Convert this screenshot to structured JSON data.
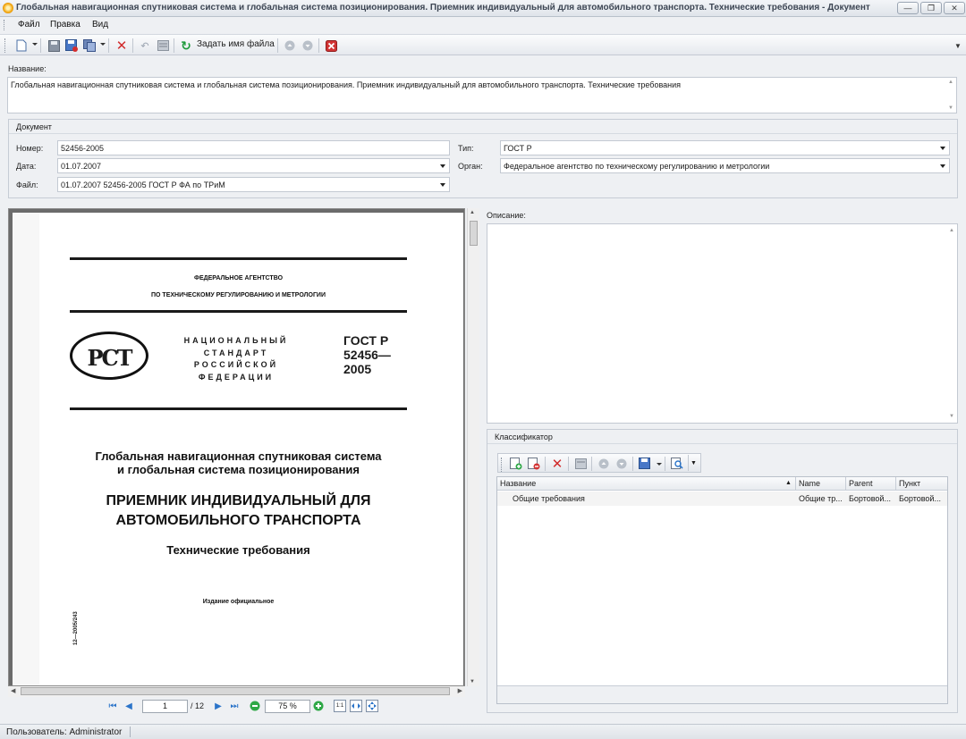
{
  "window": {
    "title": "Глобальная навигационная спутниковая система и глобальная система позиционирования. Приемник индивидуальный для автомобильного транспорта. Технические требования - Документ",
    "buttons": {
      "minimize": "—",
      "restore": "❐",
      "close": "✕"
    }
  },
  "menu": {
    "items": [
      "Файл",
      "Правка",
      "Вид"
    ]
  },
  "toolbar": {
    "set_filename_label": "Задать имя файла"
  },
  "name_section": {
    "label": "Название:",
    "value": "Глобальная навигационная спутниковая система и глобальная система позиционирования. Приемник индивидуальный для автомобильного транспорта. Технические требования"
  },
  "document": {
    "group_title": "Документ",
    "number_label": "Номер:",
    "number": "52456-2005",
    "date_label": "Дата:",
    "date": "01.07.2007",
    "file_label": "Файл:",
    "file": "01.07.2007 52456-2005  ГОСТ Р ФА по ТРиМ",
    "type_label": "Тип:",
    "type": "ГОСТ Р",
    "org_label": "Орган:",
    "org": "Федеральное агентство по техническому регулированию и метрологии"
  },
  "pdf_page": {
    "agency_line1": "ФЕДЕРАЛЬНОЕ АГЕНТСТВО",
    "agency_line2": "ПО ТЕХНИЧЕСКОМУ РЕГУЛИРОВАНИЮ И МЕТРОЛОГИИ",
    "logo_text": "РСТ",
    "nat_std": [
      "НАЦИОНАЛЬНЫЙ",
      "СТАНДАРТ",
      "РОССИЙСКОЙ",
      "ФЕДЕРАЦИИ"
    ],
    "gost_line1": "ГОСТ Р",
    "gost_line2": "52456—",
    "gost_line3": "2005",
    "title_line1": "Глобальная навигационная спутниковая система",
    "title_line2": "и глобальная система позиционирования",
    "heading_line1": "ПРИЕМНИК ИНДИВИДУАЛЬНЫЙ ДЛЯ",
    "heading_line2": "АВТОМОБИЛЬНОГО ТРАНСПОРТА",
    "subtitle": "Технические требования",
    "edition": "Издание официальное",
    "side_code": "12—2005/243"
  },
  "pdf_nav": {
    "page": "1",
    "total": "/ 12",
    "zoom": "75 %",
    "fit_actual": "1:1"
  },
  "description": {
    "label": "Описание:"
  },
  "classifier": {
    "group_title": "Классификатор",
    "columns": [
      "Название",
      "Name",
      "Parent",
      "Пункт"
    ],
    "rows": [
      {
        "name": "Общие требования",
        "name_en": "Общие тр...",
        "parent": "Бортовой...",
        "item": "Бортовой..."
      }
    ]
  },
  "status": {
    "user": "Пользователь: Administrator"
  }
}
